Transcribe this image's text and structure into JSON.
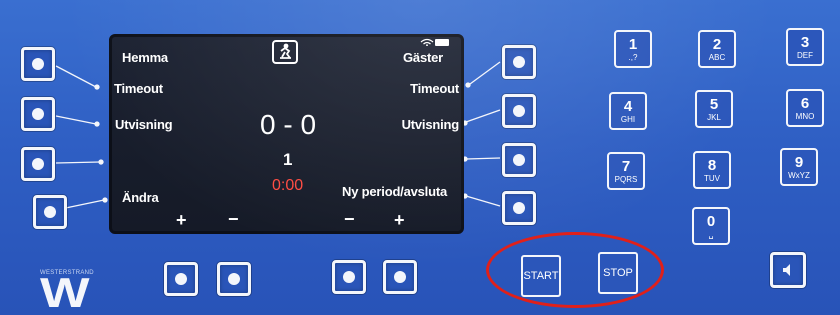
{
  "display": {
    "home_label": "Hemma",
    "away_label": "Gäster",
    "timeout_left": "Timeout",
    "timeout_right": "Timeout",
    "penalty_left": "Utvisning",
    "penalty_right": "Utvisning",
    "score": "0 - 0",
    "period": "1",
    "time": "0:00",
    "edit_label": "Ändra",
    "new_period_label": "Ny period/avsluta",
    "plus": "+",
    "minus": "−",
    "time_color": "#ff4a40",
    "logo_icon": "rink-icon",
    "status_icons": [
      "wifi-icon",
      "battery-icon"
    ]
  },
  "keypad": [
    {
      "digit": "1",
      "letters": ".,?"
    },
    {
      "digit": "2",
      "letters": "ABC"
    },
    {
      "digit": "3",
      "letters": "DEF"
    },
    {
      "digit": "4",
      "letters": "GHI"
    },
    {
      "digit": "5",
      "letters": "JKL"
    },
    {
      "digit": "6",
      "letters": "MNO"
    },
    {
      "digit": "7",
      "letters": "PQRS"
    },
    {
      "digit": "8",
      "letters": "TUV"
    },
    {
      "digit": "9",
      "letters": "WxYZ"
    },
    {
      "digit": "0",
      "letters": "␣"
    }
  ],
  "controls": {
    "start_label": "START",
    "stop_label": "STOP",
    "highlight_color": "#e0201a",
    "sound_icon": "speaker-icon"
  },
  "brand": {
    "name": "WESTERSTRAND",
    "logo_letter": "W"
  },
  "colors": {
    "panel": "#2f5fc4",
    "screen": "#1b2131"
  }
}
